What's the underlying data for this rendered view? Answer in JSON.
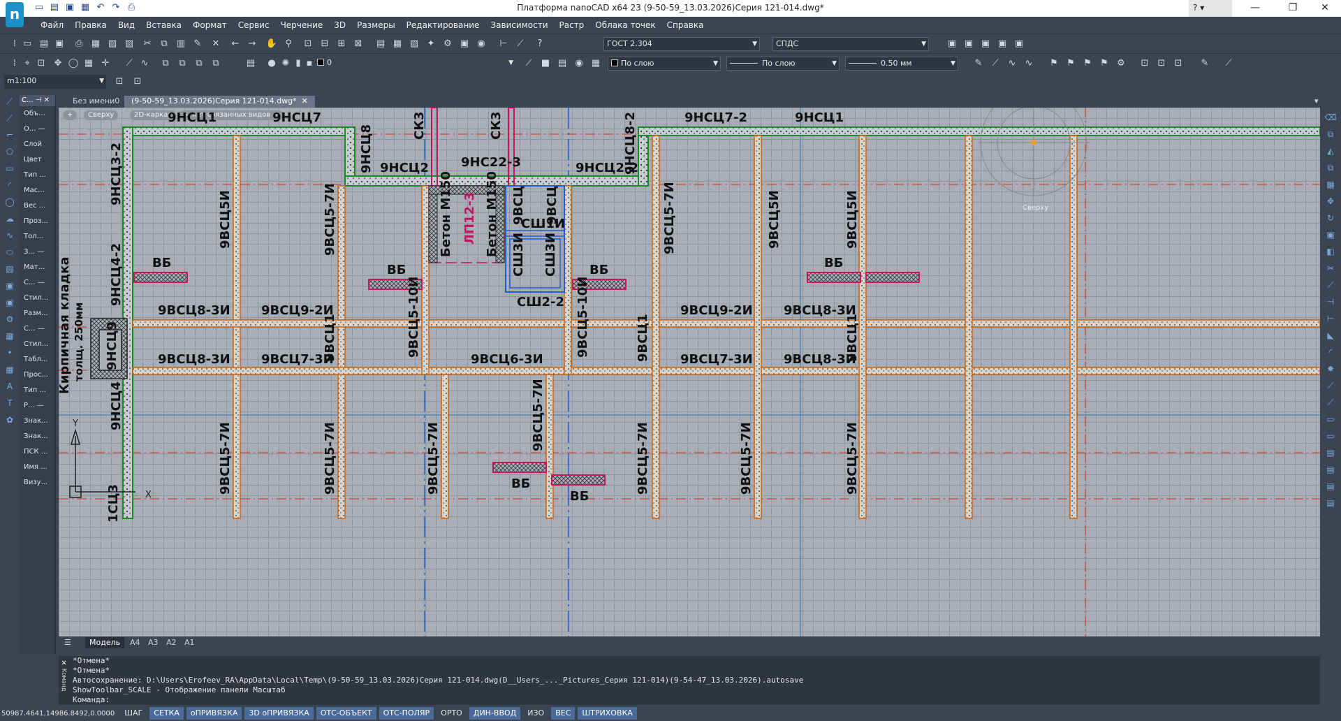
{
  "app": {
    "window_title": "Платформа nanoCAD x64 23 (9-50-59_13.03.2026)Серия 121-014.dwg*",
    "help": "?"
  },
  "menu": [
    "Файл",
    "Правка",
    "Вид",
    "Вставка",
    "Формат",
    "Сервис",
    "Черчение",
    "3D",
    "Размеры",
    "Редактирование",
    "Зависимости",
    "Растр",
    "Облака точек",
    "Справка"
  ],
  "toolbar1": {
    "text_style": "ГОСТ 2.304",
    "dim_style": "СПДС"
  },
  "toolbar2": {
    "layer": "0",
    "color": "По слою",
    "linetype": "По слою",
    "lineweight": "0.50 мм"
  },
  "scale": "m1:100",
  "property_panel": {
    "header": "С...",
    "items": [
      "Объ...",
      "О... —",
      "Слой",
      "Цвет",
      "Тип ...",
      "Мас...",
      "Вес ...",
      "Проз...",
      "Тол...",
      "З... —",
      "Мат...",
      "С... —",
      "Стил...",
      "Разм...",
      "С... —",
      "Стил...",
      "Табл...",
      "Прос...",
      "Тип ...",
      "Р... —",
      "Знак...",
      "Знак...",
      "ПСК ...",
      "Имя ...",
      "Визу..."
    ]
  },
  "doc_tabs": [
    "Без имени0",
    "(9-50-59_13.03.2026)Серия 121-014.dwg*"
  ],
  "viewport_controls": [
    "+",
    "Сверху",
    "2D-каркас",
    "— нет связанных видов —"
  ],
  "viewcube_label": "Сверху",
  "drawing": {
    "wall_labels_top": [
      "9НСЦ1",
      "9НСЦ7",
      "9НСЦ8",
      "9НСЦ2",
      "9НС22-3",
      "9НСЦ2-2",
      "9НСЦ8-2",
      "9НСЦ7-2",
      "9НСЦ1"
    ],
    "shaft_labels": [
      "СК3",
      "СК3"
    ],
    "vertical_labels": [
      "9НСЦ3-2",
      "9НСЦ4-2",
      "9НСЦ4",
      "9ВСЦ5И",
      "9ВСЦ5-7И",
      "9ВСЦ5-10И",
      "9ВСЦ5-10И",
      "9ВСЦ5-7И",
      "9ВСЦ5И",
      "9ВСЦ5И",
      "9ВСЦ1",
      "9ВСЦ1",
      "9ВСЦ1",
      "9ВСЦ5-7И",
      "9ВСЦ5-7И",
      "9ВСЦ5-7И",
      "9ВСЦ5-7И",
      "9ВСЦ5-7И",
      "9ВСЦ5-7И",
      "9ВСЦ5-7И",
      "9НСЦ9"
    ],
    "horizontal_labels": [
      "9ВСЦ8-3И",
      "9ВСЦ9-2И",
      "9ВСЦ9-2И",
      "9ВСЦ8-3И",
      "9ВСЦ8-3И",
      "9ВСЦ7-3И",
      "9ВСЦ6-3И",
      "9ВСЦ7-3И",
      "9ВСЦ8-3И"
    ],
    "vb_labels": [
      "ВБ",
      "ВБ",
      "ВБ",
      "ВБ",
      "ВБ",
      "ВБ"
    ],
    "elevator": [
      "Бетон М150",
      "ЛП12-3",
      "Бетон М150",
      "9ВСЦ",
      "9ВСЦ",
      "СШ1И",
      "СШ3И",
      "СШ3И",
      "СШ2-2"
    ],
    "note_line1": "Кирпичная кладка",
    "note_line2": "толщ. 250мм",
    "axis_y": "Y",
    "axis_x": "X",
    "bottom_left_label": "1СЦ3"
  },
  "layout_tabs": [
    "Модель",
    "A4",
    "A3",
    "A2",
    "A1"
  ],
  "command_lines": [
    "*Отмена*",
    "*Отмена*",
    "Автосохранение: D:\\Users\\Erofeev_RA\\AppData\\Local\\Temp\\(9-50-59_13.03.2026)Серия 121-014.dwg(D__Users_..._Pictures_Серия 121-014)(9-54-47_13.03.2026).autosave",
    "ShowToolbar_SCALE - Отображение панели Масштаб",
    "Команда:"
  ],
  "command_side_label": "Команд",
  "status": {
    "coords": "50987.4641,14986.8492,0.0000",
    "buttons": [
      {
        "label": "ШАГ",
        "on": false
      },
      {
        "label": "СЕТКА",
        "on": true
      },
      {
        "label": "оПРИВЯЗКА",
        "on": true
      },
      {
        "label": "3D оПРИВЯЗКА",
        "on": true
      },
      {
        "label": "ОТС-ОБЪЕКТ",
        "on": true
      },
      {
        "label": "ОТС-ПОЛЯР",
        "on": true
      },
      {
        "label": "ОРТО",
        "on": false
      },
      {
        "label": "ДИН-ВВОД",
        "on": true
      },
      {
        "label": "ИЗО",
        "on": false
      },
      {
        "label": "ВЕС",
        "on": true
      },
      {
        "label": "ШТРИХОВКА",
        "on": true
      }
    ]
  },
  "colors": {
    "wall_green": "#1b8a2a",
    "wall_orange": "#c86414",
    "axis_red": "#e0262a",
    "magenta": "#c41463",
    "blue": "#1f5fd0",
    "grid_bg": "#a9aeb6",
    "ui_bg": "#3b4453"
  }
}
